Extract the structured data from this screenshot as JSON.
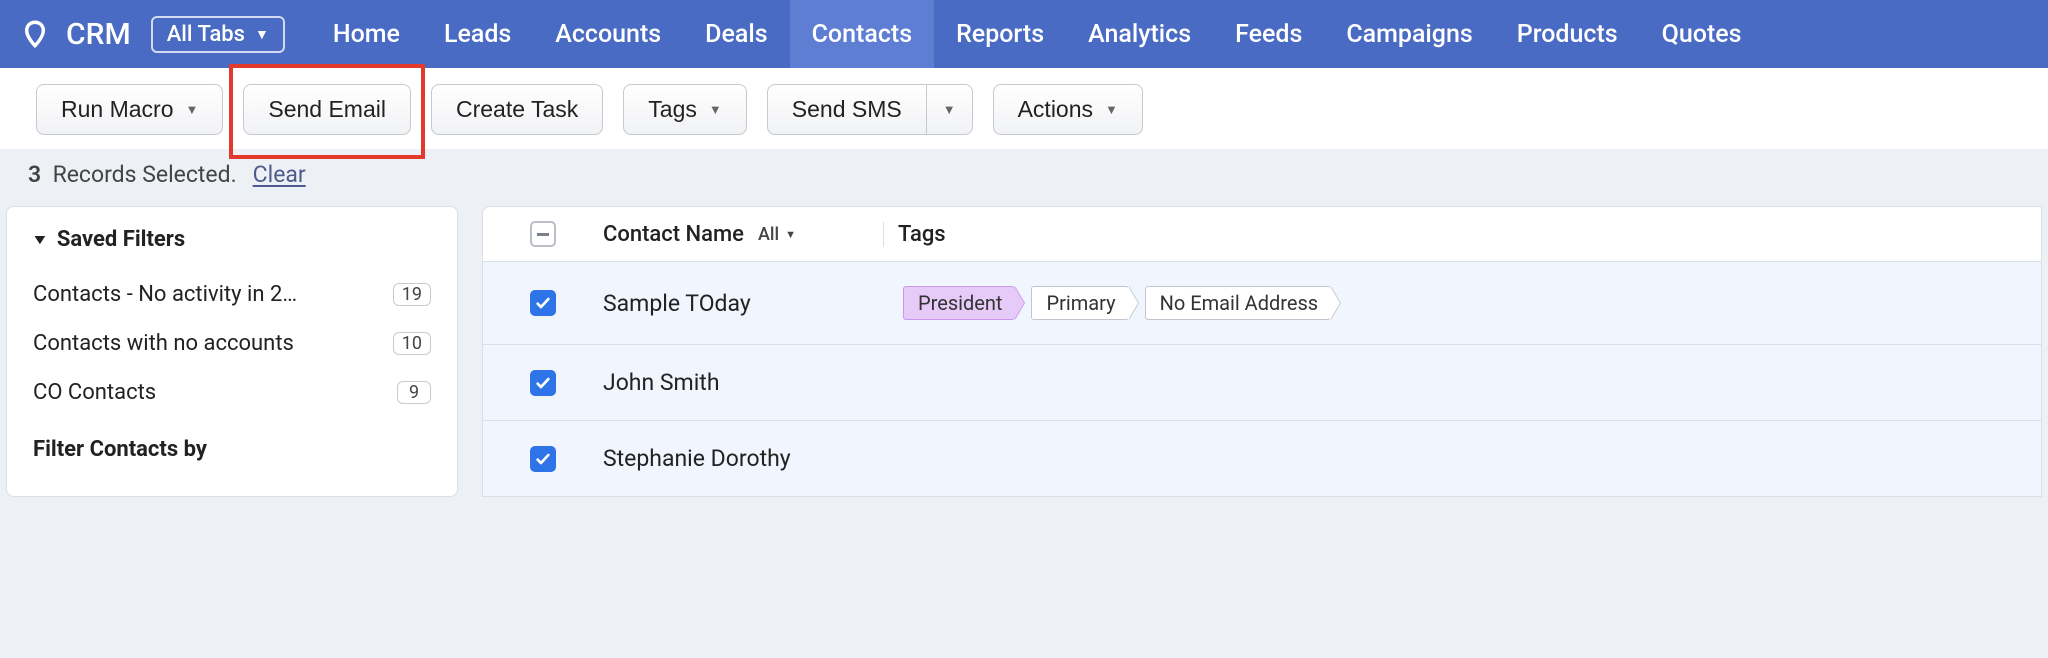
{
  "app": {
    "name": "CRM"
  },
  "all_tabs_label": "All Tabs",
  "nav": [
    {
      "label": "Home",
      "active": false
    },
    {
      "label": "Leads",
      "active": false
    },
    {
      "label": "Accounts",
      "active": false
    },
    {
      "label": "Deals",
      "active": false
    },
    {
      "label": "Contacts",
      "active": true
    },
    {
      "label": "Reports",
      "active": false
    },
    {
      "label": "Analytics",
      "active": false
    },
    {
      "label": "Feeds",
      "active": false
    },
    {
      "label": "Campaigns",
      "active": false
    },
    {
      "label": "Products",
      "active": false
    },
    {
      "label": "Quotes",
      "active": false
    }
  ],
  "toolbar": {
    "run_macro": "Run Macro",
    "send_email": "Send Email",
    "create_task": "Create Task",
    "tags": "Tags",
    "send_sms": "Send SMS",
    "actions": "Actions"
  },
  "selection": {
    "count": "3",
    "text": "Records Selected.",
    "clear": "Clear"
  },
  "sidebar": {
    "saved_filters_title": "Saved Filters",
    "filters": [
      {
        "name": "Contacts - No activity in 2…",
        "count": "19"
      },
      {
        "name": "Contacts with no accounts",
        "count": "10"
      },
      {
        "name": "CO Contacts",
        "count": "9"
      }
    ],
    "filter_by_title": "Filter Contacts by"
  },
  "table": {
    "header": {
      "contact_name": "Contact Name",
      "all_label": "All",
      "tags": "Tags"
    },
    "rows": [
      {
        "checked": true,
        "name": "Sample TOday",
        "tags": [
          {
            "label": "President",
            "variant": "president"
          },
          {
            "label": "Primary",
            "variant": "plain"
          },
          {
            "label": "No Email Address",
            "variant": "plain"
          }
        ]
      },
      {
        "checked": true,
        "name": "John Smith",
        "tags": []
      },
      {
        "checked": true,
        "name": "Stephanie Dorothy",
        "tags": []
      }
    ]
  }
}
